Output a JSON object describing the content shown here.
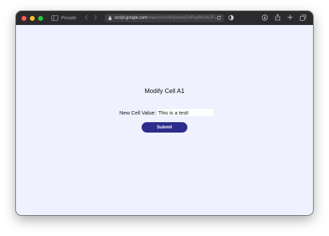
{
  "browser": {
    "private_label": "Private",
    "address_host": "script.google.com",
    "address_path": "/macros/s/AKfycbweEihRxpRKw6JFi...",
    "colors": {
      "close": "#ff5f57",
      "minimize": "#febc2e",
      "maximize": "#28c840",
      "toolbar": "#2b2b2d"
    },
    "icons": [
      "sidebar-icon",
      "back-icon",
      "forward-icon",
      "lock-icon",
      "reload-icon",
      "shield-icon",
      "download-icon",
      "share-icon",
      "new-tab-icon",
      "tab-overview-icon"
    ]
  },
  "form": {
    "title": "Modify Cell A1",
    "label": "New Cell Value:",
    "input_value": "This is a test!",
    "submit_label": "Submit",
    "colors": {
      "background": "#eff1ff",
      "button": "#2e2d8c"
    }
  }
}
